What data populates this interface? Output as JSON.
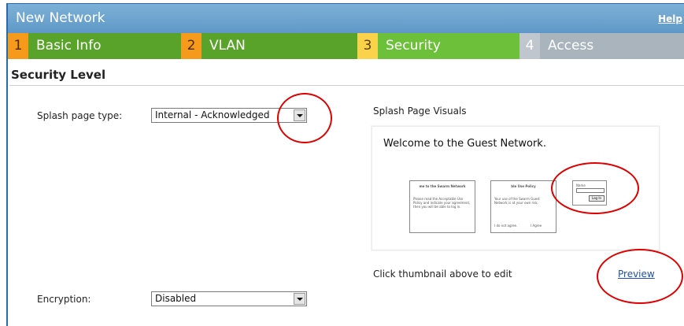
{
  "window": {
    "title": "New Network",
    "help": "Help"
  },
  "tabs": [
    {
      "num": "1",
      "label": "Basic Info",
      "state": "done"
    },
    {
      "num": "2",
      "label": "VLAN",
      "state": "done"
    },
    {
      "num": "3",
      "label": "Security",
      "state": "current"
    },
    {
      "num": "4",
      "label": "Access",
      "state": "upcoming"
    }
  ],
  "section": {
    "title": "Security Level"
  },
  "splash": {
    "label": "Splash page type:",
    "value": "Internal - Acknowledged"
  },
  "visuals": {
    "heading": "Splash Page Visuals",
    "welcome": "Welcome to the Guest Network.",
    "thumb1_title": "me to the Swarm Network",
    "thumb1_body": "Please read the Acceptable Use Policy and indicate your agreement, then you will be able to log in.",
    "thumb2_title": "ble Use Policy",
    "thumb2_body": "Your use of the Swarm Guest Network is at your own risk.",
    "thumb2_opt1": "I do not agree.",
    "thumb2_opt2": "I Agree",
    "thumb3_label": "Name",
    "thumb3_button": "Log In",
    "hint": "Click thumbnail above to edit",
    "preview": "Preview"
  },
  "encryption": {
    "label": "Encryption:",
    "value": "Disabled"
  },
  "colors": {
    "titlebar": "#6aa3cf",
    "tab_done": "#59a32a",
    "tab_current": "#6cc03a",
    "tab_upcoming": "#aab4bd",
    "annotation": "#e00000",
    "link": "#1f4fa3"
  }
}
